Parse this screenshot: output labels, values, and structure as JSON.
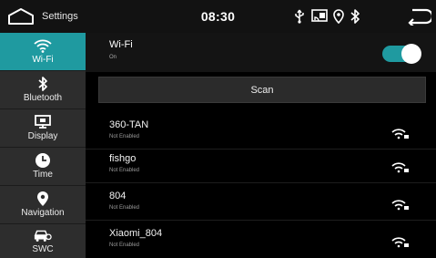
{
  "status_bar": {
    "title": "Settings",
    "time": "08:30",
    "icons": [
      "usb-icon",
      "screen-mirror-icon",
      "location-icon",
      "bluetooth-icon"
    ],
    "back": "back-arrow-icon"
  },
  "sidebar": {
    "items": [
      {
        "label": "Wi-Fi",
        "icon": "wifi-icon",
        "active": true
      },
      {
        "label": "Bluetooth",
        "icon": "bluetooth-icon"
      },
      {
        "label": "Display",
        "icon": "display-icon"
      },
      {
        "label": "Time",
        "icon": "clock-icon"
      },
      {
        "label": "Navigation",
        "icon": "location-pin-icon"
      },
      {
        "label": "SWC",
        "icon": "steering-wheel-control-icon"
      }
    ]
  },
  "wifi": {
    "title": "Wi-Fi",
    "state": "On",
    "enabled": true
  },
  "scan_label": "Scan",
  "networks": [
    {
      "name": "360-TAN",
      "status": "Not Enabled",
      "icon": "wifi-locked-icon"
    },
    {
      "name": "fishgo",
      "status": "Not Enabled",
      "icon": "wifi-locked-icon"
    },
    {
      "name": "804",
      "status": "Not Enabled",
      "icon": "wifi-locked-icon"
    },
    {
      "name": "Xiaomi_804",
      "status": "Not Enabled",
      "icon": "wifi-locked-icon"
    }
  ],
  "colors": {
    "accent": "#1f9aa0",
    "sidebar_item": "#2d2d2d",
    "status_bar": "#121212"
  }
}
